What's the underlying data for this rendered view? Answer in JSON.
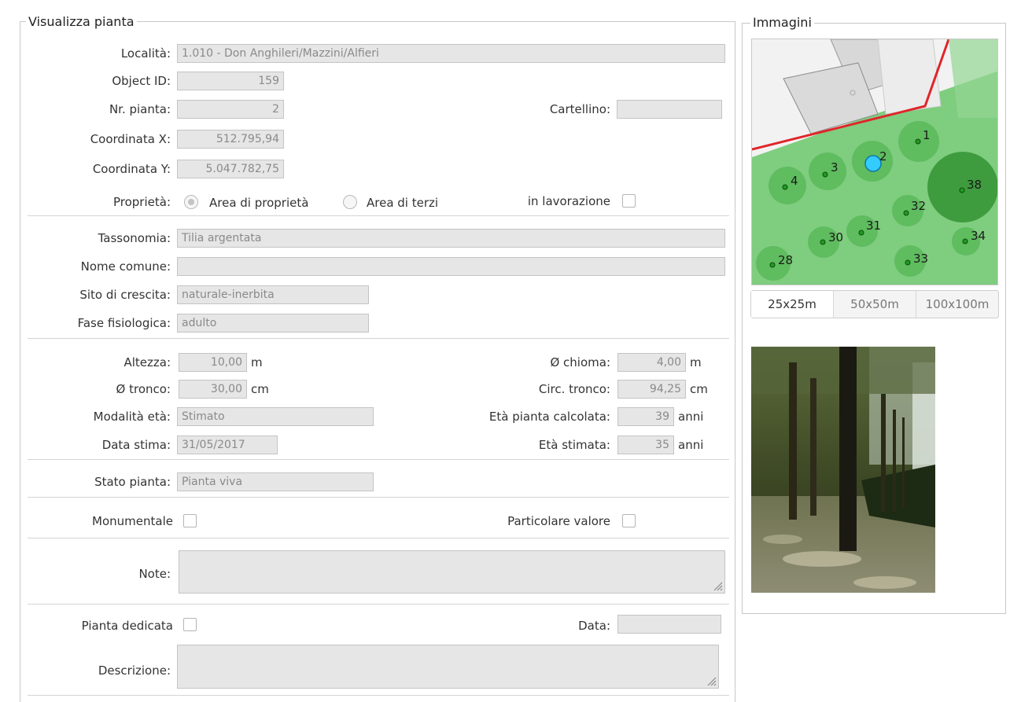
{
  "form": {
    "legend": "Visualizza pianta",
    "localita": {
      "label": "Località:",
      "value": "1.010 - Don Anghileri/Mazzini/Alfieri"
    },
    "object_id": {
      "label": "Object ID:",
      "value": "159"
    },
    "nr_pianta": {
      "label": "Nr. pianta:",
      "value": "2"
    },
    "cartellino": {
      "label": "Cartellino:",
      "value": ""
    },
    "coord_x": {
      "label": "Coordinata X:",
      "value": "512.795,94"
    },
    "coord_y": {
      "label": "Coordinata Y:",
      "value": "5.047.782,75"
    },
    "proprieta": {
      "label": "Proprietà:",
      "option1": "Area di proprietà",
      "option2": "Area di terzi",
      "selected": "Area di proprietà"
    },
    "in_lavorazione": {
      "label": "in lavorazione",
      "checked": false
    },
    "tassonomia": {
      "label": "Tassonomia:",
      "value": "Tilia argentata"
    },
    "nome_comune": {
      "label": "Nome comune:",
      "value": ""
    },
    "sito_crescita": {
      "label": "Sito di crescita:",
      "value": "naturale-inerbita"
    },
    "fase_fisiologica": {
      "label": "Fase fisiologica:",
      "value": "adulto"
    },
    "altezza": {
      "label": "Altezza:",
      "value": "10,00",
      "unit": "m"
    },
    "chioma": {
      "label": "Ø chioma:",
      "value": "4,00",
      "unit": "m"
    },
    "tronco": {
      "label": "Ø tronco:",
      "value": "30,00",
      "unit": "cm"
    },
    "circ_tronco": {
      "label": "Circ. tronco:",
      "value": "94,25",
      "unit": "cm"
    },
    "modalita_eta": {
      "label": "Modalità età:",
      "value": "Stimato"
    },
    "eta_calcolata": {
      "label": "Età pianta calcolata:",
      "value": "39",
      "unit": "anni"
    },
    "data_stima": {
      "label": "Data stima:",
      "value": "31/05/2017"
    },
    "eta_stimata": {
      "label": "Età stimata:",
      "value": "35",
      "unit": "anni"
    },
    "stato_pianta": {
      "label": "Stato pianta:",
      "value": "Pianta viva"
    },
    "monumentale": {
      "label": "Monumentale",
      "checked": false
    },
    "particolare_valore": {
      "label": "Particolare valore",
      "checked": false
    },
    "note": {
      "label": "Note:",
      "value": ""
    },
    "pianta_dedicata": {
      "label": "Pianta dedicata",
      "checked": false
    },
    "data": {
      "label": "Data:",
      "value": ""
    },
    "descrizione": {
      "label": "Descrizione:",
      "value": ""
    }
  },
  "images": {
    "legend": "Immagini",
    "map_trees": [
      "1",
      "2",
      "3",
      "4",
      "38",
      "32",
      "31",
      "30",
      "34",
      "28",
      "33"
    ],
    "selected_tree": "2",
    "scale_tabs": [
      "25x25m",
      "50x50m",
      "100x100m"
    ],
    "active_scale": "25x25m"
  },
  "colors": {
    "field_bg": "#e6e6e6",
    "field_text": "#8a8a8a",
    "map_green": "#8fd18f",
    "selected_tree": "#33ccff",
    "boundary": "#e0252a"
  }
}
